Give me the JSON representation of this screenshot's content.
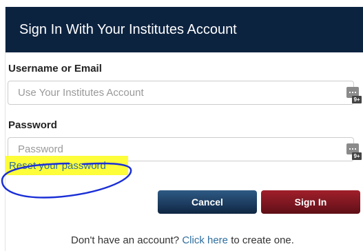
{
  "header": {
    "title": "Sign In With Your Institutes Account"
  },
  "form": {
    "username_label": "Username or Email",
    "username_placeholder": "Use Your Institutes Account",
    "username_value": "",
    "password_label": "Password",
    "password_placeholder": "Password",
    "password_value": "",
    "reset_link": "Reset your password",
    "password_manager_icon": "password-manager-icon",
    "password_manager_badge": "9+"
  },
  "buttons": {
    "cancel": "Cancel",
    "sign_in": "Sign In"
  },
  "footer": {
    "prefix": "Don't have an account?",
    "link": "Click here",
    "suffix": "to create one."
  },
  "colors": {
    "header_bg": "#0c2340",
    "cancel_bg": "#1c3b5e",
    "sign_in_bg": "#7a1620",
    "link": "#2f6e9e",
    "highlight": "#fdfd3a",
    "annotation_circle": "#1a2fd6"
  }
}
